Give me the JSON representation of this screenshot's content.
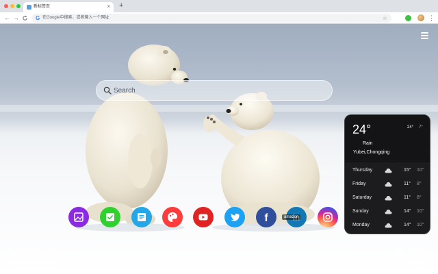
{
  "browser": {
    "tab_title": "新标签页",
    "tab_close": "×",
    "new_tab": "+",
    "nav_back": "←",
    "nav_forward": "→",
    "nav_reload": "C",
    "omnibox_placeholder": "在Google中搜索，或者输入一个网址",
    "google_g": "G",
    "star": "☆",
    "menu": "⋮"
  },
  "search": {
    "placeholder": "Search"
  },
  "shortcuts": [
    {
      "name": "gallery",
      "color": "#8a2be2"
    },
    {
      "name": "tasks",
      "color": "#2fd12f"
    },
    {
      "name": "notes",
      "color": "#24a7e8"
    },
    {
      "name": "paint",
      "color": "#ff3b3b"
    },
    {
      "name": "youtube",
      "color": "#e02323"
    },
    {
      "name": "twitter",
      "color": "#1da1f2"
    },
    {
      "name": "facebook",
      "color": "#2f4f9d",
      "glyph": "f"
    },
    {
      "name": "linkedin",
      "color": "#1178b3",
      "glyph": "in"
    },
    {
      "name": "instagram",
      "color": "#d6249f"
    }
  ],
  "tooltip": "amazon",
  "weather": {
    "temp": "24°",
    "hi": "24°",
    "lo": "7°",
    "condition": "Rain",
    "location": "Yubei,Chongqing",
    "forecast": [
      {
        "day": "Thursday",
        "hi": "15°",
        "lo": "10°",
        "icon": "cloud-icon"
      },
      {
        "day": "Friday",
        "hi": "11°",
        "lo": "8°",
        "icon": "cloud-icon"
      },
      {
        "day": "Saturday",
        "hi": "11°",
        "lo": "8°",
        "icon": "cloud-icon"
      },
      {
        "day": "Sunday",
        "hi": "14°",
        "lo": "10°",
        "icon": "cloud-icon"
      },
      {
        "day": "Monday",
        "hi": "14°",
        "lo": "10°",
        "icon": "cloud-icon"
      }
    ]
  },
  "clock": "12:00 am",
  "bottom_temp": "24°"
}
